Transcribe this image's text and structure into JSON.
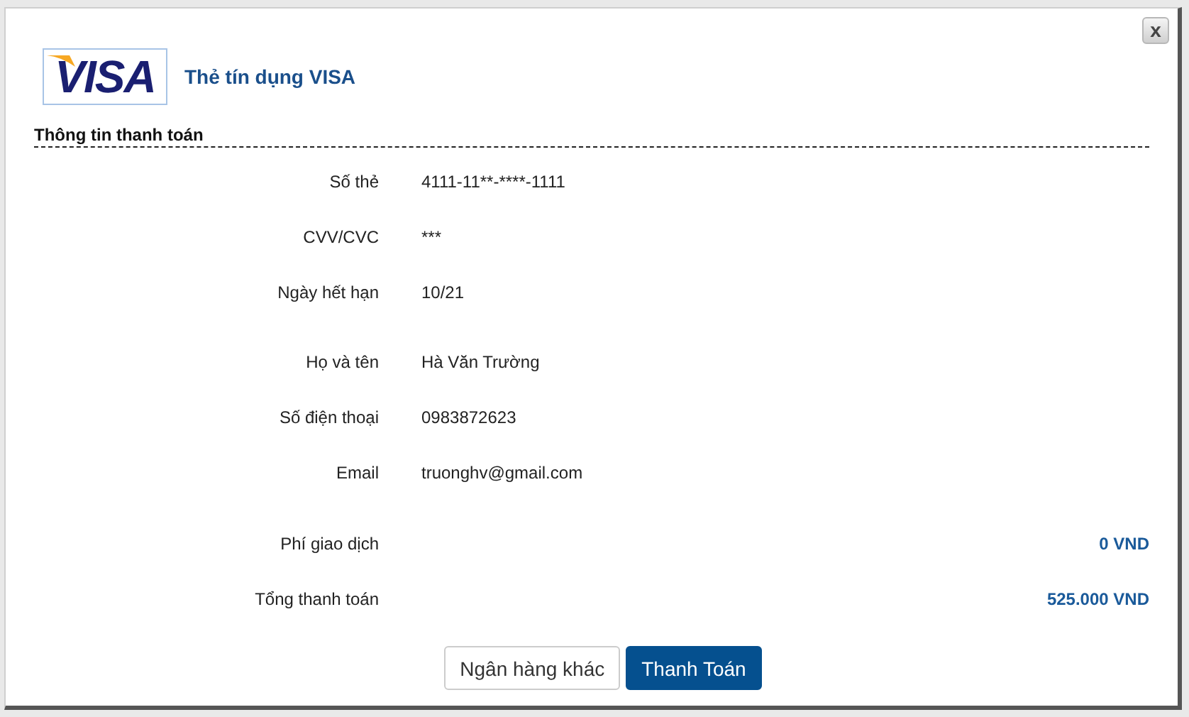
{
  "close_button": "x",
  "header": {
    "logo": "VISA",
    "title": "Thẻ tín dụng VISA"
  },
  "section_title": "Thông tin thanh toán",
  "card_fields": [
    {
      "label": "Số thẻ",
      "value": "4111-11**-****-1111"
    },
    {
      "label": "CVV/CVC",
      "value": "***"
    },
    {
      "label": "Ngày hết hạn",
      "value": "10/21"
    }
  ],
  "holder_fields": [
    {
      "label": "Họ và tên",
      "value": "Hà Văn Trường"
    },
    {
      "label": "Số điện thoại",
      "value": "0983872623"
    },
    {
      "label": "Email",
      "value": "truonghv@gmail.com"
    }
  ],
  "totals": [
    {
      "label": "Phí giao dịch",
      "amount": "0 VND"
    },
    {
      "label": "Tổng thanh toán",
      "amount": "525.000 VND"
    }
  ],
  "buttons": [
    {
      "label": "Ngân hàng khác",
      "kind": "secondary"
    },
    {
      "label": "Thanh Toán",
      "kind": "primary"
    }
  ]
}
